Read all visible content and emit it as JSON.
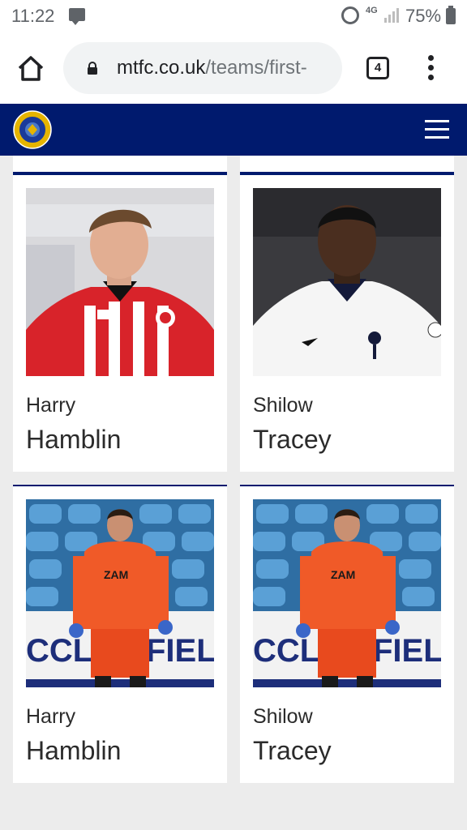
{
  "status_bar": {
    "time": "11:22",
    "network": "4G",
    "battery": "75%"
  },
  "browser": {
    "url_host": "mtfc.co.uk",
    "url_path": "/teams/first-",
    "tab_count": "4"
  },
  "site": {
    "brand_color": "#001a6e"
  },
  "players": [
    {
      "first_name": "Harry",
      "last_name": "Hamblin",
      "photo": "player-red-striped-kit"
    },
    {
      "first_name": "Shilow",
      "last_name": "Tracey",
      "photo": "player-white-kit"
    },
    {
      "first_name": "Harry",
      "last_name": "Hamblin",
      "photo": "goalkeeper-orange-kit"
    },
    {
      "first_name": "Shilow",
      "last_name": "Tracey",
      "photo": "goalkeeper-orange-kit"
    }
  ]
}
